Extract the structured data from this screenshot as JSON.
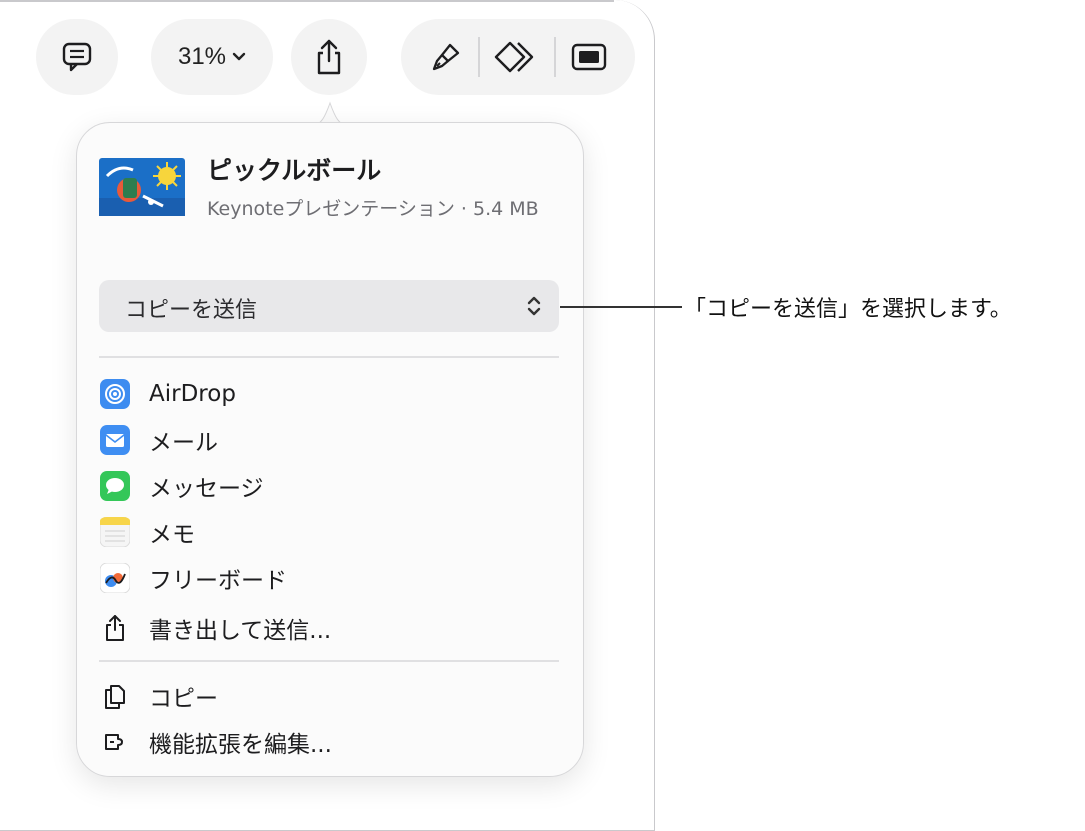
{
  "toolbar": {
    "zoom_label": "31%",
    "icons": [
      "comment-icon",
      "chevron-down-icon",
      "share-icon",
      "paintbrush-icon",
      "animate-icon",
      "present-icon"
    ]
  },
  "share_popover": {
    "document": {
      "title": "ピックルボール",
      "subtitle": "Keynoteプレゼンテーション · 5.4 MB"
    },
    "send_option": {
      "label": "コピーを送信"
    },
    "destinations": [
      {
        "label": "AirDrop",
        "icon": "airdrop-icon",
        "color": "#3d8cf0"
      },
      {
        "label": "メール",
        "icon": "mail-icon",
        "color": "#3f8ef2"
      },
      {
        "label": "メッセージ",
        "icon": "messages-icon",
        "color": "#34c759"
      },
      {
        "label": "メモ",
        "icon": "notes-icon",
        "color": "#f7d54a"
      },
      {
        "label": "フリーボード",
        "icon": "freeform-icon",
        "color": "#ffffff"
      },
      {
        "label": "書き出して送信...",
        "icon": "export-share-icon",
        "color": "#1d1d1f"
      }
    ],
    "actions": [
      {
        "label": "コピー",
        "icon": "copy-icon"
      },
      {
        "label": "機能拡張を編集...",
        "icon": "extensions-icon"
      }
    ]
  },
  "callout": {
    "text": "「コピーを送信」を選択します。"
  }
}
